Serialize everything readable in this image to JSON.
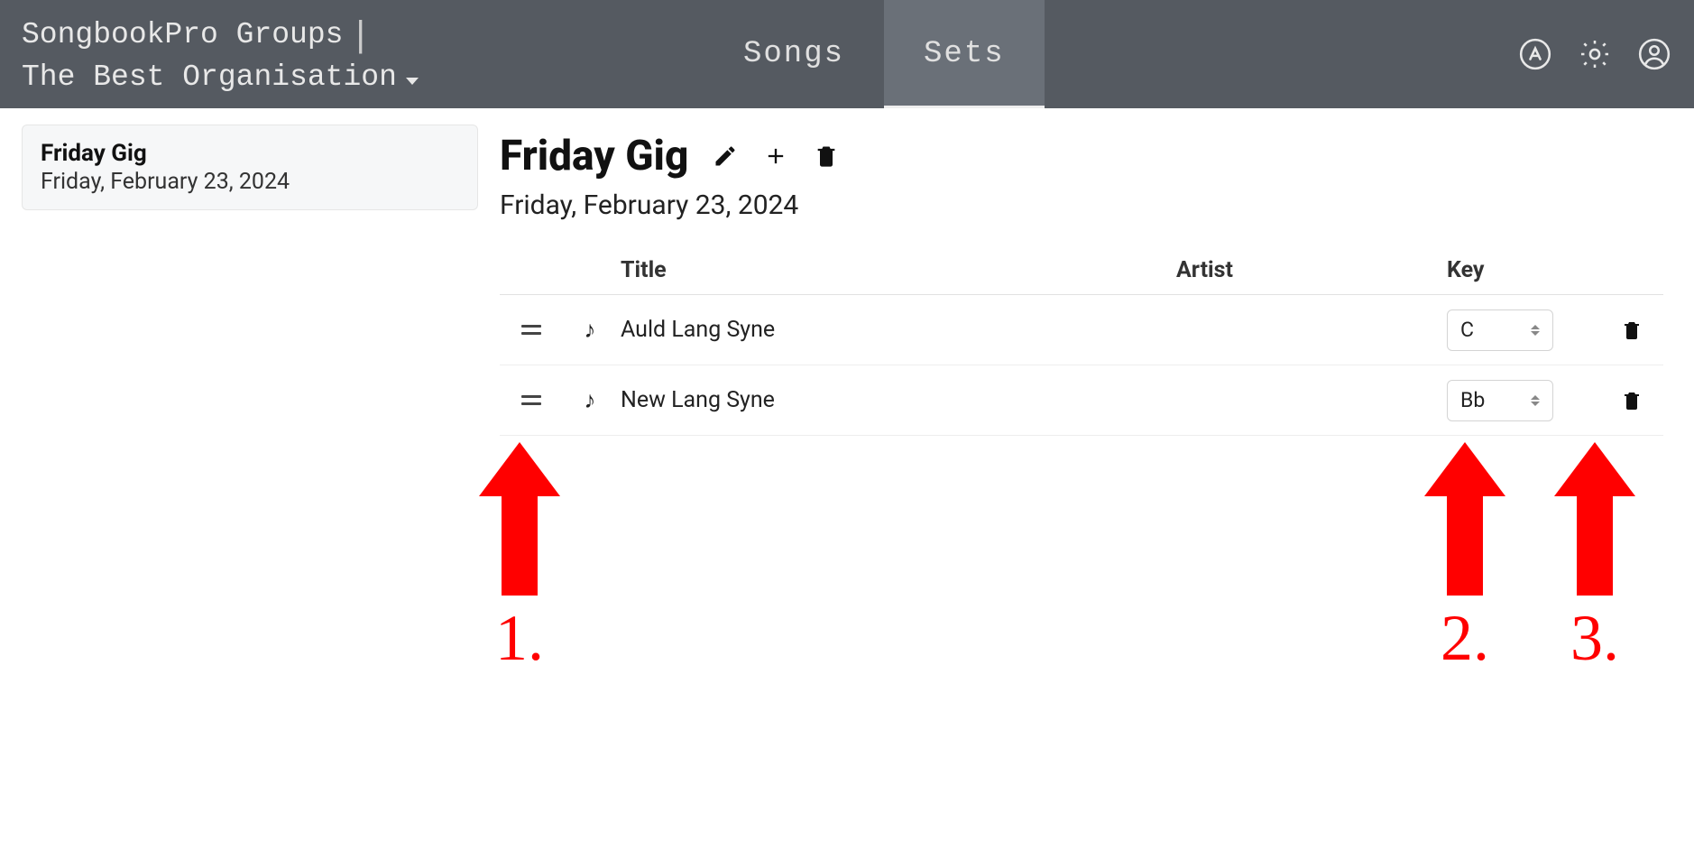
{
  "header": {
    "app_title": "SongbookPro Groups",
    "org_name": "The Best Organisation",
    "tabs": {
      "songs": "Songs",
      "sets": "Sets"
    }
  },
  "sidebar": {
    "sets": [
      {
        "title": "Friday Gig",
        "date": "Friday, February 23, 2024"
      }
    ]
  },
  "main": {
    "title": "Friday Gig",
    "date": "Friday, February 23, 2024",
    "columns": {
      "title": "Title",
      "artist": "Artist",
      "key": "Key"
    },
    "songs": [
      {
        "title": "Auld Lang Syne",
        "artist": "",
        "key": "C"
      },
      {
        "title": "New Lang Syne",
        "artist": "",
        "key": "Bb"
      }
    ]
  },
  "annotations": {
    "a1": "1.",
    "a2": "2.",
    "a3": "3."
  }
}
